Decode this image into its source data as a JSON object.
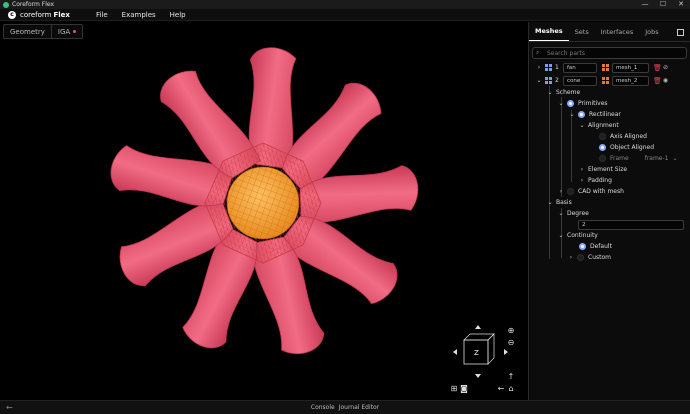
{
  "window": {
    "title": "Coreform Flex",
    "controls": [
      "—",
      "☐",
      "✕"
    ]
  },
  "menubar": {
    "brand_light": "coreform",
    "brand_bold": "Flex",
    "items": [
      "File",
      "Examples",
      "Help"
    ]
  },
  "viewport": {
    "tabs": [
      "Geometry",
      "IGA"
    ],
    "cube_label": "Z",
    "colors": {
      "blade": "#e8566f",
      "mesh": "#c23c3c",
      "hub": "#f0a030"
    }
  },
  "statusbar": {
    "left": "Console",
    "right": "Journal Editor"
  },
  "panel": {
    "tabs": [
      "Meshes",
      "Sets",
      "Interfaces",
      "Jobs"
    ],
    "search_placeholder": "Search parts",
    "parts": [
      {
        "index": "1",
        "name": "fan",
        "mesh": "mesh_1",
        "visibility": "hidden"
      },
      {
        "index": "2",
        "name": "cone",
        "mesh": "mesh_2",
        "visibility": "visible"
      }
    ],
    "tree": {
      "scheme": "Scheme",
      "primitives": "Primitives",
      "rectilinear": "Rectilinear",
      "alignment": "Alignment",
      "axis_aligned": "Axis Aligned",
      "object_aligned": "Object Aligned",
      "frame": "Frame",
      "frame_value": "frame-1",
      "element_size": "Element Size",
      "padding": "Padding",
      "cad_with_mesh": "CAD with mesh",
      "basis": "Basis",
      "degree": "Degree",
      "degree_value": "2",
      "continuity": "Continuity",
      "default": "Default",
      "custom": "Custom"
    }
  }
}
